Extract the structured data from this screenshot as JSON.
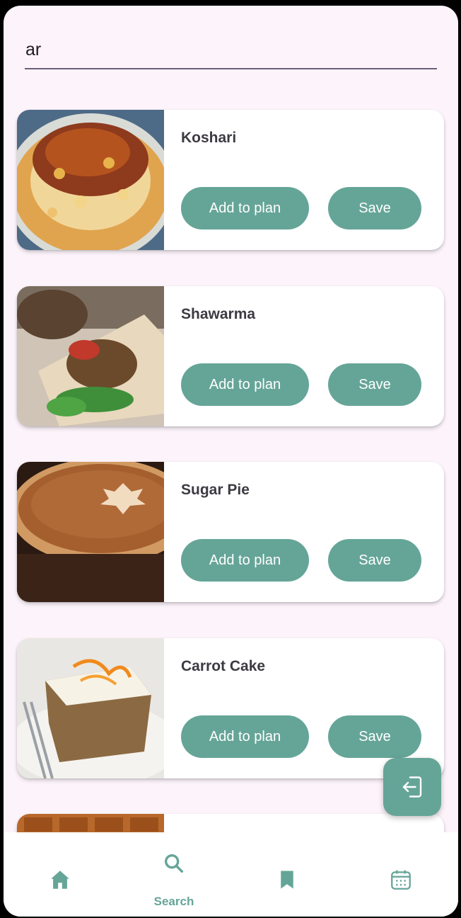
{
  "search": {
    "value": "ar"
  },
  "meals": [
    {
      "name": "Koshari",
      "plan_label": "Add to plan",
      "save_label": "Save"
    },
    {
      "name": "Shawarma",
      "plan_label": "Add to plan",
      "save_label": "Save"
    },
    {
      "name": "Sugar Pie",
      "plan_label": "Add to plan",
      "save_label": "Save"
    },
    {
      "name": "Carrot Cake",
      "plan_label": "Add to plan",
      "save_label": "Save"
    },
    {
      "name": "",
      "plan_label": "",
      "save_label": ""
    }
  ],
  "fab": {
    "icon": "logout-icon"
  },
  "nav": {
    "items": [
      {
        "icon": "home-icon",
        "label": ""
      },
      {
        "icon": "search-icon",
        "label": "Search"
      },
      {
        "icon": "bookmark-icon",
        "label": ""
      },
      {
        "icon": "calendar-icon",
        "label": ""
      }
    ]
  },
  "colors": {
    "accent": "#65a598",
    "background": "#fdf4fb",
    "title_text": "#3d3a42"
  }
}
